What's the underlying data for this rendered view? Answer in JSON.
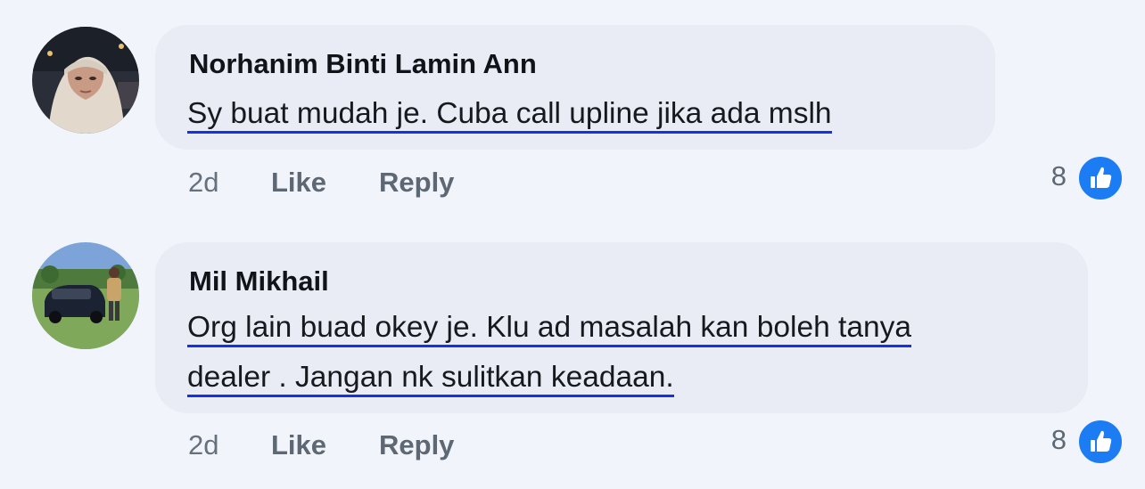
{
  "colors": {
    "page_bg": "#f1f4fa",
    "bubble_bg": "#e9ecf5",
    "underline": "#1432e0",
    "like_badge": "#1c7cf4"
  },
  "comments": [
    {
      "author": "Norhanim Binti Lamin Ann",
      "text_lines": [
        "Sy buat mudah je. Cuba call upline jika ada mslh"
      ],
      "time": "2d",
      "like_label": "Like",
      "reply_label": "Reply",
      "reaction_count": "8",
      "reaction_icon": "thumbs-up-icon",
      "avatar": "profile-photo-woman-hijab"
    },
    {
      "author": "Mil Mikhail",
      "text_lines": [
        "Org lain buad okey je. Klu ad masalah kan boleh tanya",
        "dealer . Jangan nk sulitkan keadaan."
      ],
      "time": "2d",
      "like_label": "Like",
      "reply_label": "Reply",
      "reaction_count": "8",
      "reaction_icon": "thumbs-up-icon",
      "avatar": "profile-photo-man-with-car"
    }
  ]
}
